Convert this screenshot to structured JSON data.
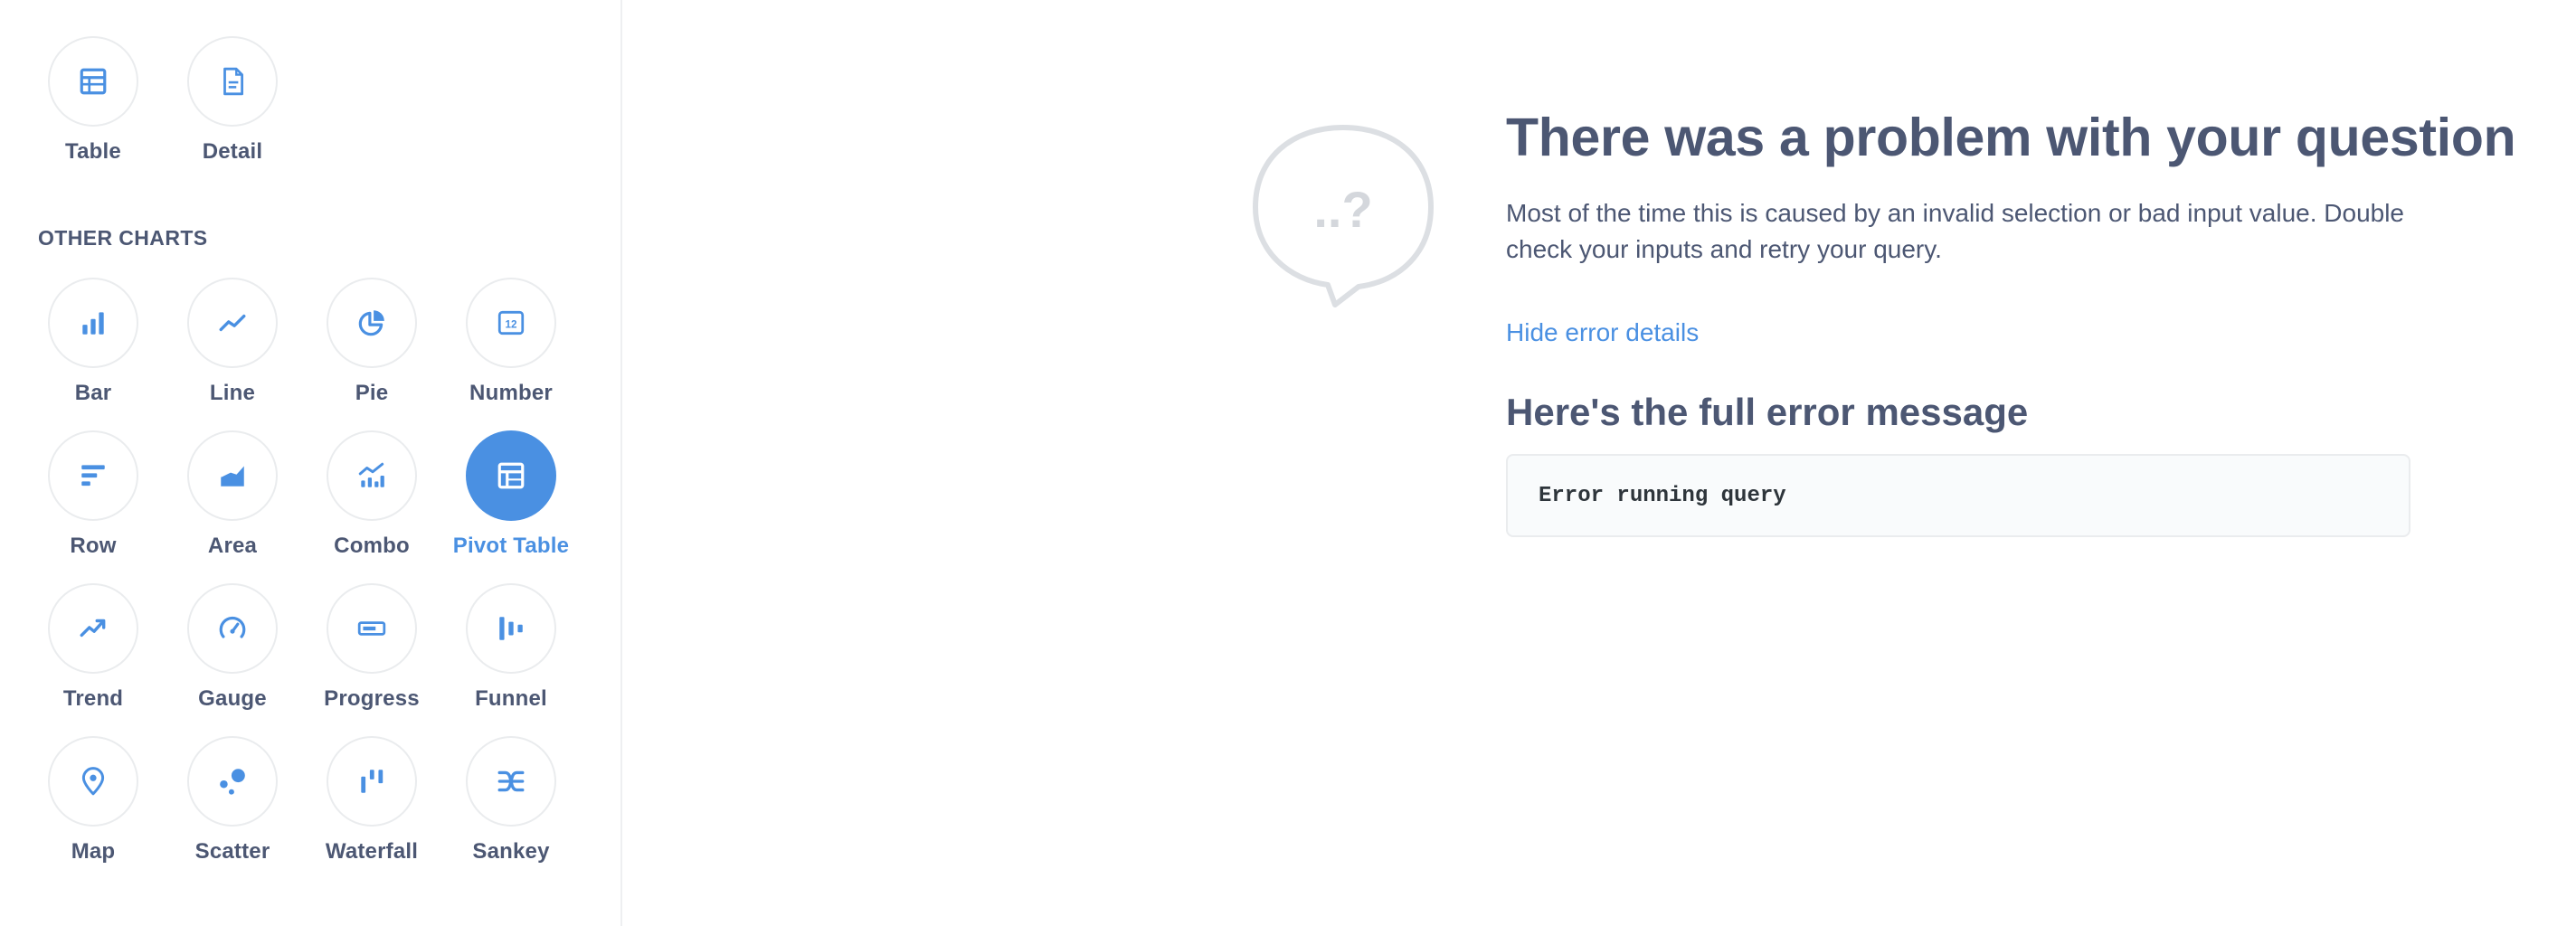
{
  "sidebar": {
    "top_items": [
      {
        "label": "Table",
        "icon": "table-icon"
      },
      {
        "label": "Detail",
        "icon": "detail-icon"
      }
    ],
    "section_heading": "OTHER CHARTS",
    "other_charts": [
      {
        "label": "Bar",
        "icon": "bar-chart-icon"
      },
      {
        "label": "Line",
        "icon": "line-chart-icon"
      },
      {
        "label": "Pie",
        "icon": "pie-chart-icon"
      },
      {
        "label": "Number",
        "icon": "number-icon"
      },
      {
        "label": "Row",
        "icon": "row-chart-icon"
      },
      {
        "label": "Area",
        "icon": "area-chart-icon"
      },
      {
        "label": "Combo",
        "icon": "combo-chart-icon"
      },
      {
        "label": "Pivot Table",
        "icon": "pivot-table-icon",
        "selected": true
      },
      {
        "label": "Trend",
        "icon": "trend-icon"
      },
      {
        "label": "Gauge",
        "icon": "gauge-icon"
      },
      {
        "label": "Progress",
        "icon": "progress-icon"
      },
      {
        "label": "Funnel",
        "icon": "funnel-icon"
      },
      {
        "label": "Map",
        "icon": "map-pin-icon"
      },
      {
        "label": "Scatter",
        "icon": "scatter-icon"
      },
      {
        "label": "Waterfall",
        "icon": "waterfall-icon"
      },
      {
        "label": "Sankey",
        "icon": "sankey-icon"
      }
    ]
  },
  "error": {
    "illustration_icon": "speech-bubble-question-icon",
    "bubble_text": "..?",
    "title": "There was a problem with your question",
    "body": "Most of the time this is caused by an invalid selection or bad input value. Double check your inputs and retry your query.",
    "toggle_details_label": "Hide error details",
    "full_message_heading": "Here's the full error message",
    "message": "Error running query"
  },
  "colors": {
    "accent": "#4a90e2",
    "text": "#4c5773",
    "border": "#eaecee",
    "code_bg": "#f9fbfc",
    "bubble": "#dcdfe3"
  }
}
